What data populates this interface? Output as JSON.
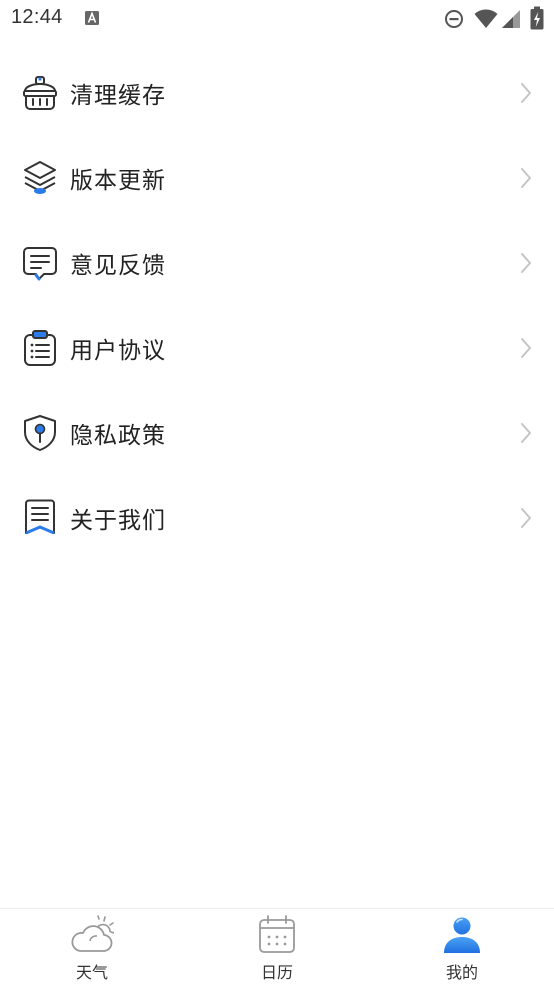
{
  "status_bar": {
    "time": "12:44",
    "icons": [
      "notification-a-icon",
      "do-not-disturb-icon",
      "wifi-icon",
      "signal-icon",
      "battery-charging-icon"
    ]
  },
  "menu": {
    "items": [
      {
        "label": "清理缓存",
        "icon": "broom-basket-icon"
      },
      {
        "label": "版本更新",
        "icon": "layers-icon"
      },
      {
        "label": "意见反馈",
        "icon": "feedback-chat-icon"
      },
      {
        "label": "用户协议",
        "icon": "clipboard-icon"
      },
      {
        "label": "隐私政策",
        "icon": "shield-key-icon"
      },
      {
        "label": "关于我们",
        "icon": "bookmark-doc-icon"
      }
    ]
  },
  "tab_bar": {
    "tabs": [
      {
        "label": "天气",
        "icon": "cloud-sun-icon",
        "active": false
      },
      {
        "label": "日历",
        "icon": "calendar-icon",
        "active": false
      },
      {
        "label": "我的",
        "icon": "user-icon",
        "active": true
      }
    ]
  },
  "colors": {
    "accent": "#2b7be8",
    "icon_stroke": "#333333",
    "chevron": "#c4c4c4",
    "divider": "#ececec"
  }
}
